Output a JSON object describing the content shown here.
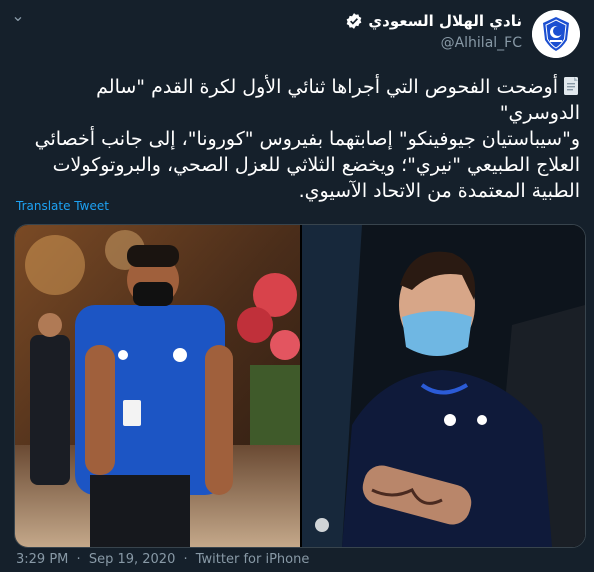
{
  "account": {
    "display_name": "نادي الهلال السعودي",
    "handle": "@Alhilal_FC"
  },
  "tweet": {
    "lines": [
      "أوضحت الفحوص التي أجراها ثنائي الأول لكرة القدم \"سالم الدوسري\"",
      "و\"سيباستيان جيوفينكو\" إصابتهما بفيروس \"كورونا\"، إلى جانب أخصائي",
      "العلاج الطبيعي \"نيري\"؛ ويخضع الثلاثي للعزل الصحي، والبروتوكولات",
      "الطبية المعتمدة من الاتحاد الآسيوي."
    ],
    "translate_label": "Translate Tweet"
  },
  "footer": {
    "time": "3:29 PM",
    "separator": "·",
    "date": "Sep 19, 2020",
    "source": "Twitter for iPhone"
  },
  "icons": {
    "back": "chevron-down-icon",
    "verified": "verified-badge-icon",
    "document": "page-icon"
  },
  "colors": {
    "background": "#15202b",
    "link": "#1da1f2",
    "secondary_text": "#8899a6",
    "verified": "#1da1f2",
    "club_blue": "#1b4fd1"
  }
}
